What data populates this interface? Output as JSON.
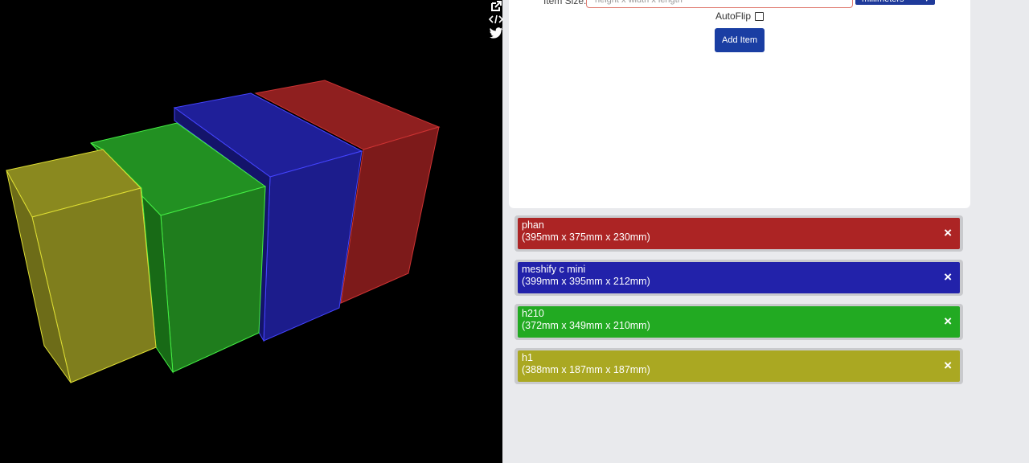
{
  "viewer": {
    "boxes": [
      {
        "name": "phan",
        "color": "#8a1e1e"
      },
      {
        "name": "meshify c mini",
        "color": "#1f1f96"
      },
      {
        "name": "h210",
        "color": "#22801f"
      },
      {
        "name": "h1",
        "color": "#7f7e1d"
      }
    ]
  },
  "side_icons": [
    "share-icon",
    "embed-code-icon",
    "twitter-icon"
  ],
  "form": {
    "item_size_label": "Item Size:",
    "item_size_placeholder": "height x width x length",
    "unit_selected": "millimeters",
    "autoflip_label": "AutoFlip",
    "autoflip_checked": false,
    "add_button_label": "Add Item"
  },
  "items": [
    {
      "name": "phan",
      "dims": "(395mm x 375mm x 230mm)",
      "color": "#ac2424",
      "remove": "×"
    },
    {
      "name": "meshify c mini",
      "dims": "(399mm x 395mm x 212mm)",
      "color": "#2222aa",
      "remove": "×"
    },
    {
      "name": "h210",
      "dims": "(372mm x 349mm x 210mm)",
      "color": "#22aa22",
      "remove": "×"
    },
    {
      "name": "h1",
      "dims": "(388mm x 187mm x 187mm)",
      "color": "#aaa822",
      "remove": "×"
    }
  ]
}
